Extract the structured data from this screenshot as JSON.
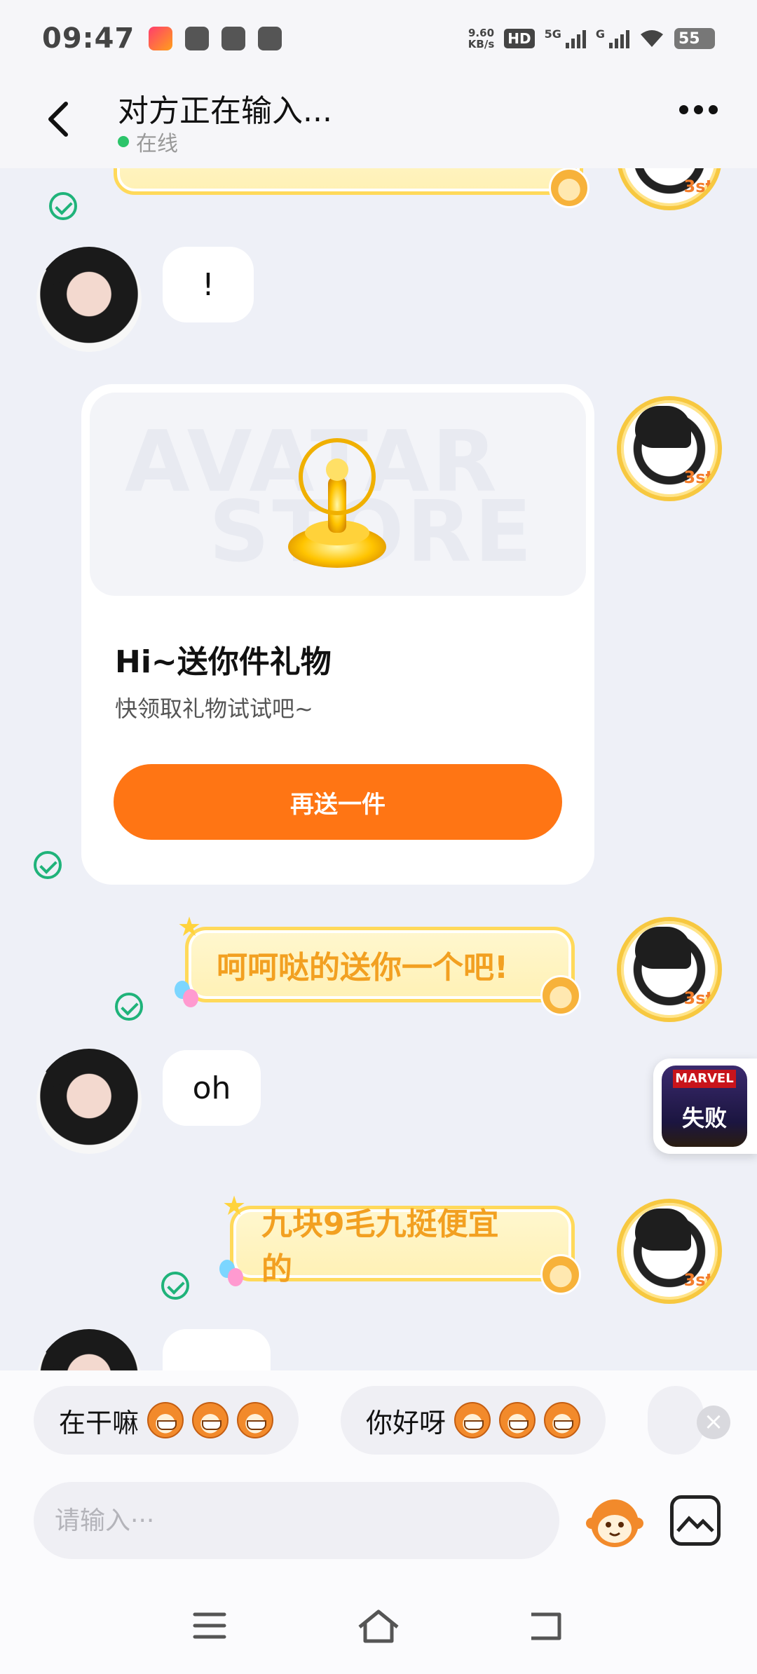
{
  "status_bar": {
    "time": "09:47",
    "speed_value": "9.60",
    "speed_unit": "KB/s",
    "hd_badge": "HD",
    "network_5g": "5G",
    "network_g": "G",
    "battery": "55"
  },
  "header": {
    "title": "对方正在输入...",
    "status": "在线"
  },
  "messages": {
    "m1_text": "!",
    "gift": {
      "watermark_top": "AVATAR",
      "watermark_bottom": "STORE",
      "title": "Hi~送你件礼物",
      "subtitle": "快领取礼物试试吧~",
      "button": "再送一件"
    },
    "m2_text": "呵呵哒的送你一个吧!",
    "m3_text": "oh",
    "m4_text": "九块9毛九挺便宜的"
  },
  "float_widget": {
    "brand": "MARVEL",
    "label": "失败"
  },
  "quick_replies": [
    {
      "label": "在干嘛"
    },
    {
      "label": "你好呀"
    }
  ],
  "input": {
    "placeholder": "请输入···"
  },
  "colors": {
    "accent_orange": "#ff7514",
    "online_green": "#2cc46a",
    "check_green": "#1fb37a",
    "fancy_text": "#f2a021"
  }
}
